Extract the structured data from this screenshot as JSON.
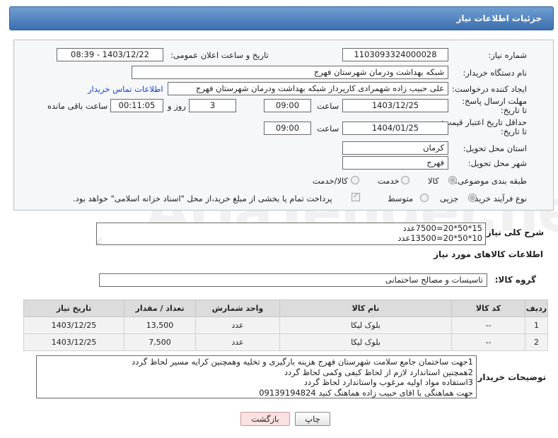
{
  "header": {
    "title": "جزئیات اطلاعات نیاز"
  },
  "form": {
    "need_number_label": "شماره نیاز:",
    "need_number": "1103093324000028",
    "announce_label": "تاریخ و ساعت اعلان عمومی:",
    "announce_value": "1403/12/22 - 08:39",
    "buyer_org_label": "نام دستگاه خریدار:",
    "buyer_org": "شبکه بهداشت ودرمان شهرستان فهرج",
    "requester_label": "ایجاد کننده درخواست:",
    "requester": "علی حبیب زاده شهمرادی کارپرداز شبکه بهداشت ودرمان شهرستان فهرج",
    "contact_link": "اطلاعات تماس خریدار",
    "deadline_label": "مهلت ارسال پاسخ: تا تاریخ:",
    "deadline_date": "1403/12/25",
    "time_label": "ساعت",
    "deadline_time": "09:00",
    "days_value": "3",
    "days_label": "روز و",
    "remaining_time": "00:11:05",
    "remaining_label": "ساعت باقی مانده",
    "validity_label": "حداقل تاریخ اعتبار قیمت: تا تاریخ:",
    "validity_date": "1404/01/25",
    "validity_time": "09:00",
    "province_label": "استان محل تحویل:",
    "province": "کرمان",
    "city_label": "شهر محل تحویل:",
    "city": "فهرج",
    "category_label": "طبقه بندی موضوعی:",
    "category_options": [
      "کالا",
      "خدمت",
      "کالا/خدمت"
    ],
    "process_label": "نوع فرآیند خرید :",
    "process_options": [
      "جزیی",
      "متوسط"
    ],
    "payment_note": "پرداخت تمام یا بخشی از مبلغ خرید،از محل \"اسناد خزانه اسلامی\" خواهد بود."
  },
  "description": {
    "label": "شرح کلی نیاز:",
    "lines": [
      "15*50*20=7500عدد",
      "10*50*20=13500عدد"
    ]
  },
  "goods": {
    "section_title": "اطلاعات کالاهای مورد نیاز",
    "group_label": "گروه کالا:",
    "group_value": "تاسیسات و مصالح ساختمانی",
    "columns": [
      "ردیف",
      "کد کالا",
      "نام کالا",
      "واحد شمارش",
      "تعداد / مقدار",
      "تاریخ نیاز"
    ],
    "rows": [
      [
        "1",
        "--",
        "بلوک لیکا",
        "عدد",
        "13,500",
        "1403/12/25"
      ],
      [
        "2",
        "--",
        "بلوک لیکا",
        "عدد",
        "7,500",
        "1403/12/25"
      ]
    ]
  },
  "notes": {
    "label": "توضیحات خریدار:",
    "text": "1جهت ساختمان جامع سلامت شهرستان فهرج هزینه بارگیری و تخلیه وهمچنین کرایه مسیر لحاظ گردد\n2همچنین استاندارد لازم از لحاظ کیفی وکمی لحاظ گردد\n3استفاده مواد اولیه مرغوب واستاندارد لحاظ گردد\nجهت هماهنگی با اقای حبیب زاده هماهنگ کنید 09139194824"
  },
  "buttons": {
    "print": "چاپ",
    "back": "بازگشت"
  },
  "watermark": "AriaTender.net"
}
